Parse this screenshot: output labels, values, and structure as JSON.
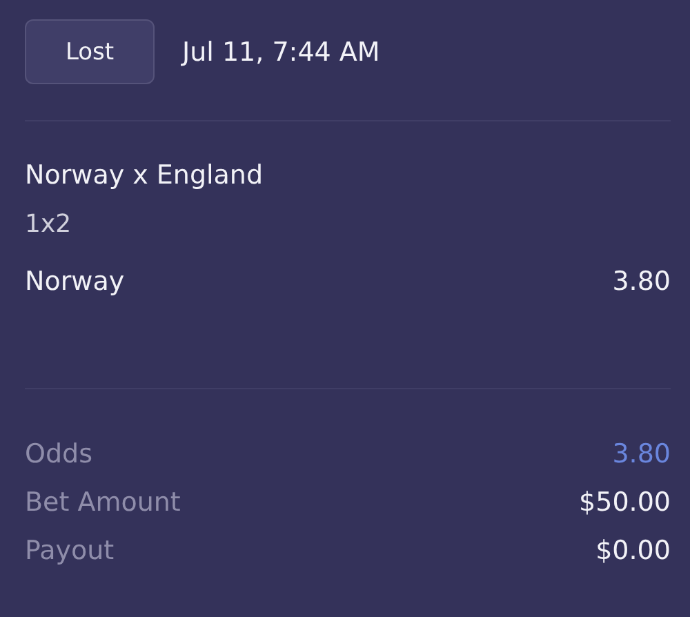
{
  "status": "Lost",
  "date": "Jul 11, 7:44 AM",
  "match": "Norway x England",
  "market": "1x2",
  "selection": {
    "name": "Norway",
    "odds": "3.80"
  },
  "summary": [
    {
      "label": "Odds",
      "value": "3.80",
      "kind": "odds"
    },
    {
      "label": "Bet Amount",
      "value": "$50.00",
      "kind": "money"
    },
    {
      "label": "Payout",
      "value": "$0.00",
      "kind": "money"
    }
  ]
}
